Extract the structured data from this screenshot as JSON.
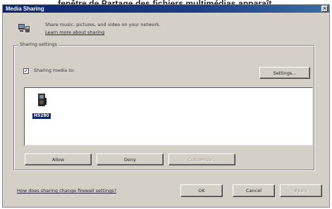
{
  "caption": "fenêtre de Partage des fichiers multimédias apparaît.",
  "window": {
    "title": "Media Sharing",
    "close_glyph": "×"
  },
  "info": {
    "icon": "media-sharing-icon",
    "text": "Share music, pictures, and video on your network.",
    "link": "Learn more about sharing"
  },
  "sharing_settings": {
    "legend": "Sharing settings",
    "checkbox_checked": true,
    "checkbox_label": "Sharing media to:",
    "settings_button": "Settings..."
  },
  "devices": [
    {
      "label": "H5280",
      "icon": "media-player-device-icon",
      "selected": true
    }
  ],
  "device_buttons": {
    "allow": "Allow",
    "deny": "Deny",
    "customize": "Customize..."
  },
  "footer": {
    "help_link": "How does sharing change firewall settings?",
    "ok": "OK",
    "cancel": "Cancel",
    "apply": "Apply"
  },
  "colors": {
    "titlebar": "#0a246a",
    "dialog_bg": "#d4d0c8",
    "selection": "#0a246a"
  }
}
